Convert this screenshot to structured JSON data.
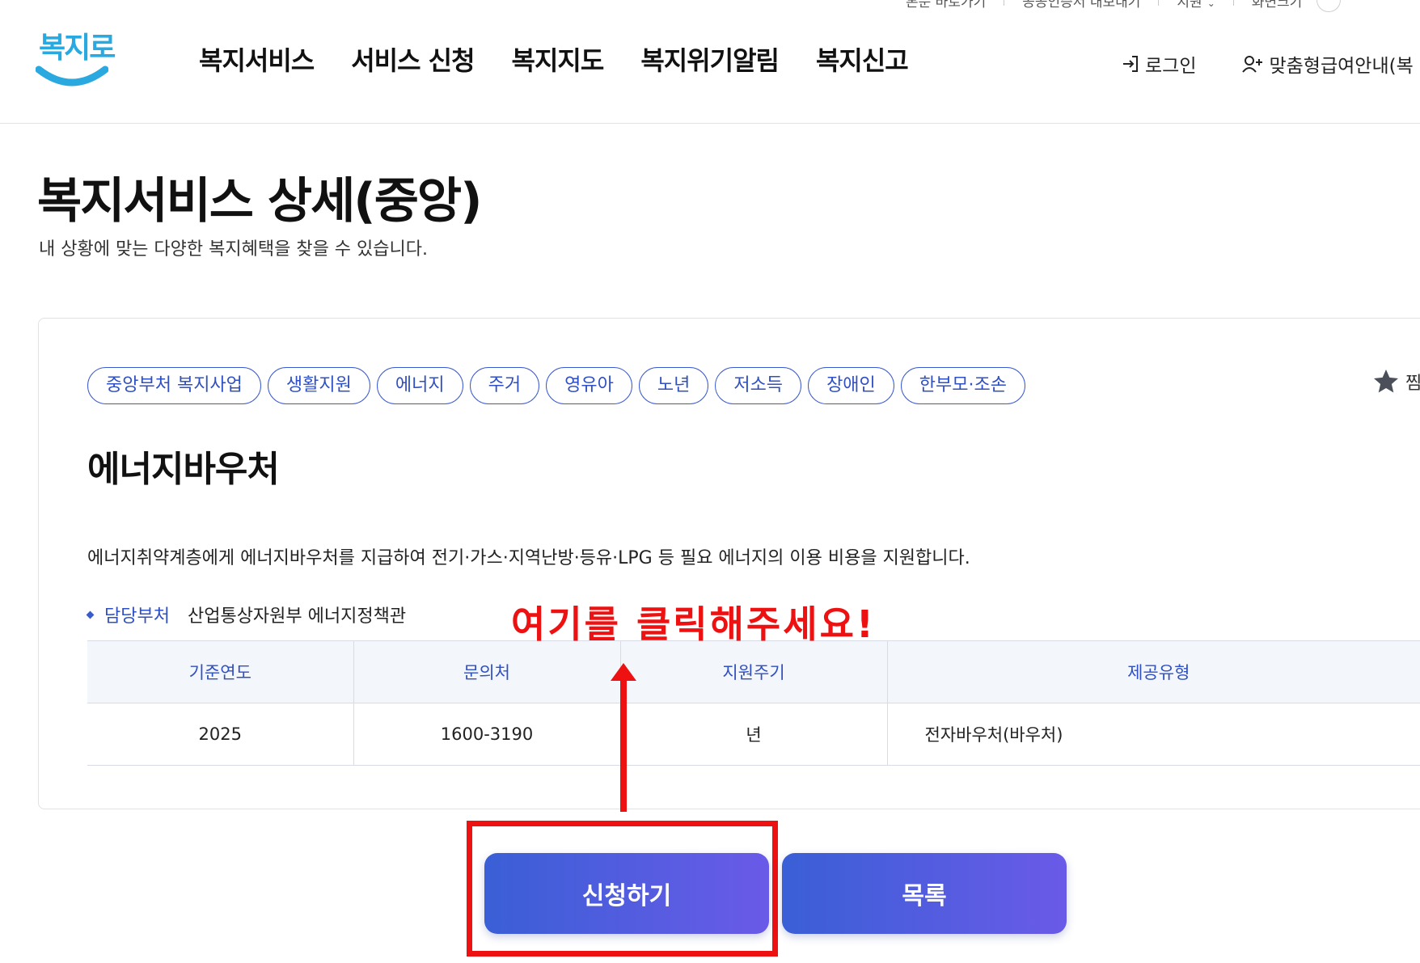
{
  "utility": {
    "skip_to_content": "본문 바로가기",
    "gov_certificate": "공공인증서 내보내기",
    "language": "지원",
    "screen_size": "화면크기"
  },
  "header": {
    "logo_text": "복지로",
    "nav": [
      {
        "label": "복지서비스"
      },
      {
        "label": "서비스 신청"
      },
      {
        "label": "복지지도"
      },
      {
        "label": "복지위기알림"
      },
      {
        "label": "복지신고"
      }
    ],
    "login_label": "로그인",
    "custom_info_label": "맞춤형급여안내(복"
  },
  "page": {
    "title": "복지서비스 상세(중앙)",
    "subtitle": "내 상황에 맞는 다양한 복지혜택을 찾을 수 있습니다."
  },
  "service": {
    "tags": [
      {
        "label": "중앙부처 복지사업"
      },
      {
        "label": "생활지원"
      },
      {
        "label": "에너지"
      },
      {
        "label": "주거"
      },
      {
        "label": "영유아"
      },
      {
        "label": "노년"
      },
      {
        "label": "저소득"
      },
      {
        "label": "장애인"
      },
      {
        "label": "한부모·조손"
      }
    ],
    "favorite_label": "찜",
    "name": "에너지바우처",
    "description": "에너지취약계층에게 에너지바우처를 지급하여 전기·가스·지역난방·등유·LPG 등 필요 에너지의 이용 비용을 지원합니다.",
    "dept_label": "담당부처",
    "dept_value": "산업통상자원부 에너지정책관",
    "table": {
      "headers": [
        "기준연도",
        "문의처",
        "지원주기",
        "제공유형"
      ],
      "row": [
        "2025",
        "1600-3190",
        "년",
        "전자바우처(바우처)"
      ]
    }
  },
  "annotation": {
    "text": "여기를 클릭해주세요!",
    "color": "#ee1111"
  },
  "actions": {
    "apply_label": "신청하기",
    "list_label": "목록"
  },
  "colors": {
    "primary": "#2f4fc4",
    "button_gradient_start": "#3a5fd6",
    "button_gradient_end": "#6a5ae8",
    "logo": "#2aa9e0"
  }
}
